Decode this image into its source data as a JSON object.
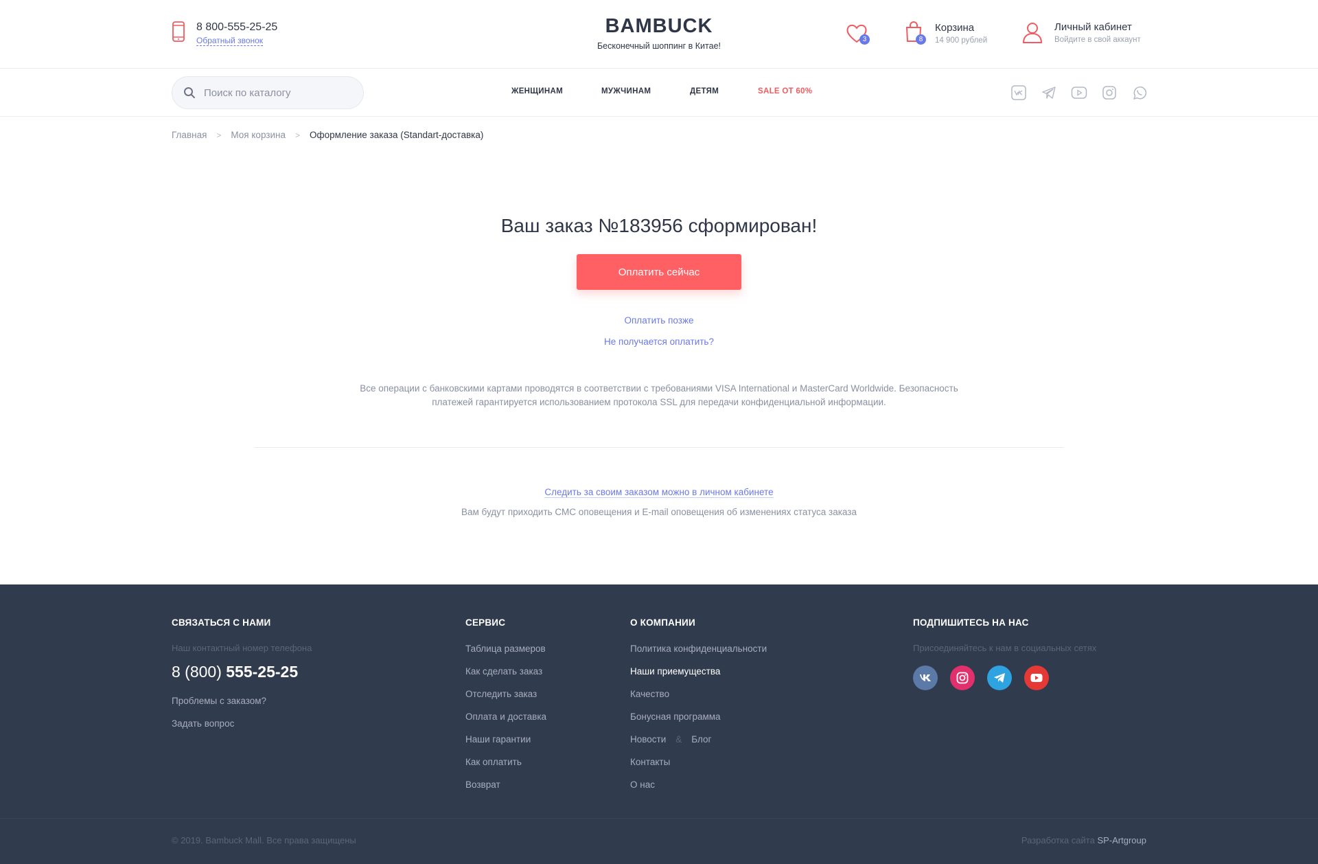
{
  "header": {
    "phone": "8 800-555-25-25",
    "callback": "Обратный звонок",
    "logo": "BAMBUCK",
    "tagline": "Бесконечный шоппинг в Китае!",
    "favorites_count": "3",
    "cart": {
      "title": "Корзина",
      "count": "8",
      "sum": "14 900 рублей"
    },
    "account": {
      "title": "Личный кабинет",
      "subtitle": "Войдите в свой аккаунт"
    },
    "accent_color": "#ff6064",
    "link_color": "#6979e8"
  },
  "nav": {
    "search_placeholder": "Поиск по каталогу",
    "menu": [
      "ЖЕНЩИНАМ",
      "МУЖЧИНАМ",
      "ДЕТЯМ",
      "SALE ОТ 60%"
    ],
    "socials": [
      "vk-icon",
      "telegram-icon",
      "youtube-icon",
      "instagram-icon",
      "whatsapp-icon"
    ]
  },
  "breadcrumb": [
    "Главная",
    "Моя корзина",
    "Оформление заказа (Standart-доставка)"
  ],
  "main": {
    "title": "Ваш заказ №183956 сформирован!",
    "pay_button": "Оплатить сейчас",
    "pay_later": "Оплатить позже",
    "cant_pay": "Не получается оплатить?",
    "notice_line1": "Все операции с банковскими картами проводятся в соответствии с требованиями VISA International и MasterCard Worldwide. Безопасность",
    "notice_line2": "платежей гарантируется использованием протокола SSL для передачи конфиденциальной информации.",
    "track_link": "Следить за своим заказом можно в личном кабинете",
    "track_note": "Вам будут приходить СМС оповещения и E-mail оповещения об изменениях статуса заказа"
  },
  "footer": {
    "contact": {
      "heading": "СВЯЗАТЬСЯ С НАМИ",
      "caption": "Наш контактный номер телефона",
      "phone_prefix": "8 (800)",
      "phone_main": "555-25-25",
      "links": [
        "Проблемы с заказом?",
        "Задать вопрос"
      ]
    },
    "service": {
      "heading": "СЕРВИС",
      "links": [
        "Таблица размеров",
        "Как сделать заказ",
        "Отследить заказ",
        "Оплата и доставка",
        "Наши гарантии",
        "Как оплатить",
        "Возврат"
      ]
    },
    "company": {
      "heading": "О КОМПАНИИ",
      "links": [
        "Политика конфиденциальности",
        "Наши приемущества",
        "Качество",
        "Бонусная программа"
      ],
      "news": "Новости",
      "amp": "&",
      "blog": "Блог",
      "links2": [
        "Контакты",
        "О нас"
      ]
    },
    "subscribe": {
      "heading": "ПОДПИШИТЕСЬ НА НАС",
      "caption": "Присоединяйтесь к нам в социальных сетях",
      "socials": [
        {
          "icon": "vk-icon",
          "color": "#5b7aa8"
        },
        {
          "icon": "instagram-icon",
          "color": "#e1306c"
        },
        {
          "icon": "telegram-icon",
          "color": "#2ea3e0"
        },
        {
          "icon": "youtube-icon",
          "color": "#e53935"
        }
      ]
    },
    "copyright": "© 2019. Bambuck Mall. Все права защищены",
    "dev_prefix": "Разработка сайта",
    "dev_name": "SP-Artgroup"
  }
}
